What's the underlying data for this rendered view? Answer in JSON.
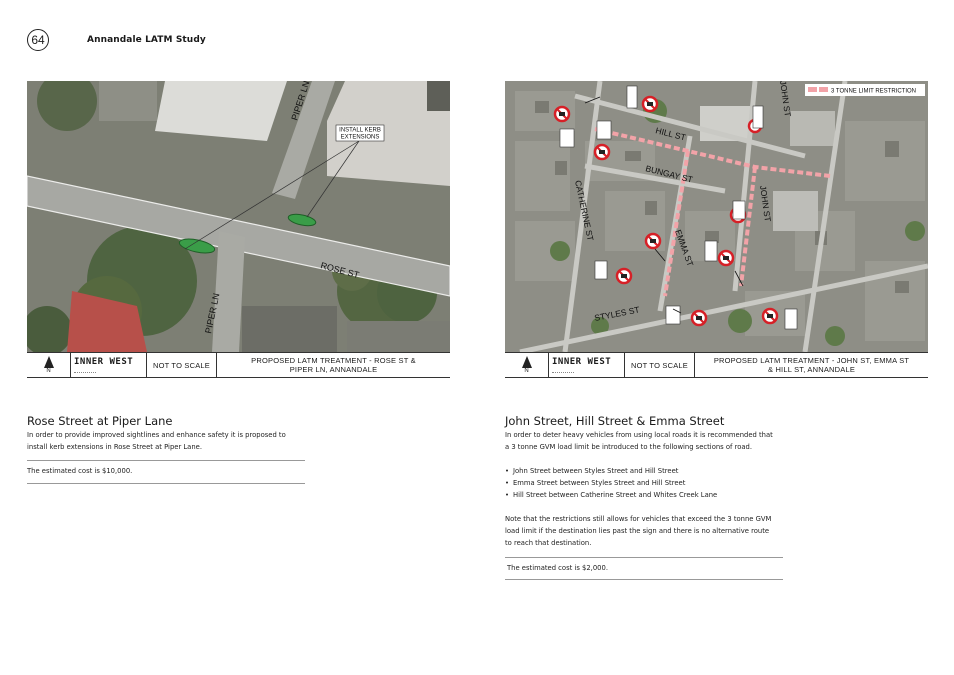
{
  "page_number": "64",
  "document_title": "Annandale LATM Study",
  "left": {
    "map": {
      "street_labels": [
        "PIPER LN",
        "ROSE ST",
        "PIPER LN"
      ],
      "callout": "INSTALL KERB\nEXTENSIONS"
    },
    "titlebar": {
      "north": "N",
      "logo": "INNER WEST",
      "scale": "NOT TO SCALE",
      "description": "PROPOSED LATM TREATMENT - ROSE ST &\nPIPER LN, ANNANDALE"
    },
    "heading": "Rose Street at Piper Lane",
    "body_line1": "In order to provide improved sightlines and enhance safety it is proposed to",
    "body_line2": "install kerb extensions in Rose Street at Piper Lane.",
    "cost": "The estimated cost is $10,000."
  },
  "right": {
    "map": {
      "legend": "3 TONNE LIMIT RESTRICTION",
      "street_labels": [
        "HILL ST",
        "BUNGAY ST",
        "CATHERINE ST",
        "JOHN ST",
        "EMMA ST",
        "STYLES ST",
        "JOHN ST"
      ]
    },
    "titlebar": {
      "north": "N",
      "logo": "INNER WEST",
      "scale": "NOT TO SCALE",
      "description": "PROPOSED LATM TREATMENT - JOHN ST, EMMA ST\n& HILL ST, ANNANDALE"
    },
    "heading": "John Street, Hill Street & Emma Street",
    "body_line1": "In order to deter heavy vehicles from using local roads it is recommended that",
    "body_line2": "a 3 tonne GVM load limit be introduced to the following sections of road.",
    "bullets": [
      "John Street between Styles Street and Hill Street",
      "Emma Street between Styles Street and Hill Street",
      "Hill Street between Catherine Street and Whites Creek Lane"
    ],
    "note_line1": "Note that the restrictions still allows for vehicles that exceed the 3 tonne GVM",
    "note_line2": "load limit if the destination lies past the sign and there is no alternative route",
    "note_line3": "to reach that destination.",
    "cost": "The estimated cost is $2,000."
  },
  "colors": {
    "restriction_line": "#f2a3a8",
    "kerb_extension": "#3a9d48",
    "sign_red": "#d62027"
  }
}
